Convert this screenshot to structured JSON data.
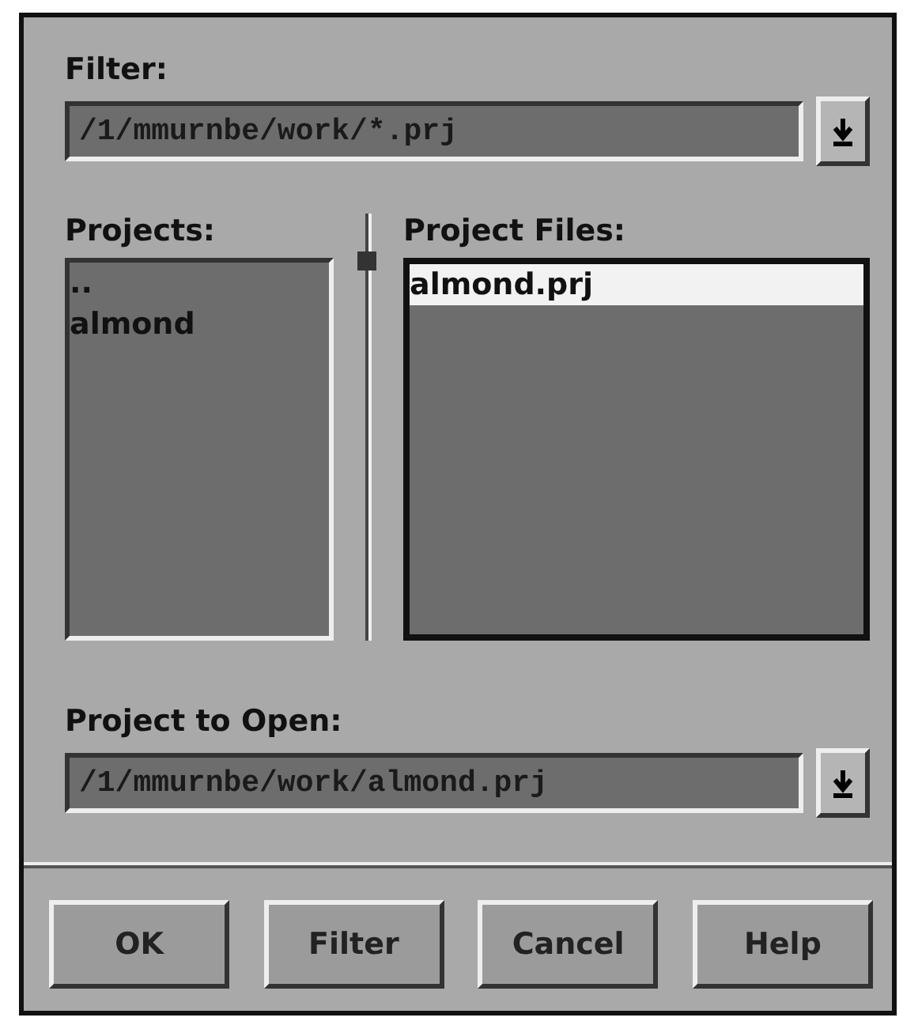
{
  "filter": {
    "label": "Filter:",
    "value": "/1/mmurnbe/work/*.prj"
  },
  "projects": {
    "label": "Projects:",
    "items": [
      {
        "text": "..",
        "selected": false
      },
      {
        "text": "almond",
        "selected": false
      }
    ]
  },
  "project_files": {
    "label": "Project Files:",
    "items": [
      {
        "text": "almond.prj",
        "selected": true
      }
    ]
  },
  "project_to_open": {
    "label": "Project to Open:",
    "value": "/1/mmurnbe/work/almond.prj"
  },
  "buttons": [
    "OK",
    "Filter",
    "Cancel",
    "Help"
  ]
}
